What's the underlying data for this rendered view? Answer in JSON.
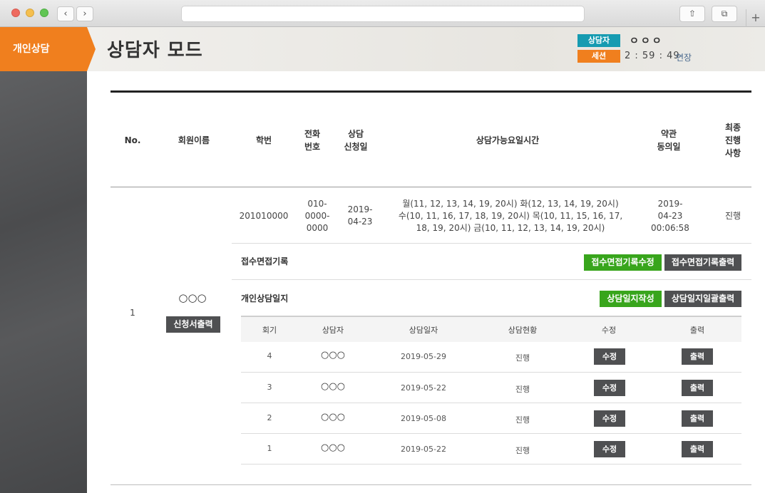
{
  "browser": {
    "back_icon": "‹",
    "forward_icon": "›",
    "share_icon": "⇧",
    "tabs_icon": "⧉",
    "newtab_icon": "+"
  },
  "header": {
    "tab_label": "개인상담",
    "page_title": "상담자 모드",
    "counselor_badge": "상담자",
    "counselor_name": "ㅇㅇㅇ",
    "session_badge": "세션",
    "timer": "2 : 59 : 49",
    "extend_label": "연장"
  },
  "table": {
    "headers": {
      "no": "No.",
      "member_name": "회원이름",
      "student_id": "학번",
      "phone": [
        "전화",
        "번호"
      ],
      "request_date": [
        "상담",
        "신청일"
      ],
      "available_time": "상담가능요일시간",
      "agreement_date": [
        "약관",
        "동의일"
      ],
      "final_status": [
        "최종",
        "진행",
        "사항"
      ]
    },
    "row": {
      "no": "1",
      "member_name": "○○○",
      "print_application_label": "신청서출력",
      "student_id": "201010000",
      "phone": [
        "010-",
        "0000-",
        "0000"
      ],
      "request_date": [
        "2019-",
        "04-23"
      ],
      "available_time": [
        "월(11, 12, 13, 14, 19, 20시) 화(12, 13, 14, 19, 20시)",
        "수(10, 11, 16, 17, 18, 19, 20시) 목(10, 11, 15, 16, 17,",
        "18, 19, 20시) 금(10, 11, 12, 13, 14, 19, 20시)"
      ],
      "agreement_date": [
        "2019-",
        "04-23",
        "00:06:58"
      ],
      "final_status": "진행"
    }
  },
  "intake": {
    "label": "접수면접기록",
    "edit_label": "접수면접기록수정",
    "print_label": "접수면접기록출력"
  },
  "journal": {
    "label": "개인상담일지",
    "write_label": "상담일지작성",
    "print_all_label": "상담일지일괄출력",
    "headers": {
      "session": "회기",
      "counselor": "상담자",
      "date": "상담일자",
      "status": "상담현황",
      "edit": "수정",
      "print": "출력"
    },
    "rows": [
      {
        "session": "4",
        "counselor": "○○○",
        "date": "2019-05-29",
        "status": "진행",
        "edit": "수정",
        "print": "출력"
      },
      {
        "session": "3",
        "counselor": "○○○",
        "date": "2019-05-22",
        "status": "진행",
        "edit": "수정",
        "print": "출력"
      },
      {
        "session": "2",
        "counselor": "○○○",
        "date": "2019-05-08",
        "status": "진행",
        "edit": "수정",
        "print": "출력"
      },
      {
        "session": "1",
        "counselor": "○○○",
        "date": "2019-05-22",
        "status": "진행",
        "edit": "수정",
        "print": "출력"
      }
    ]
  },
  "colors": {
    "accent_orange": "#f07f1e",
    "badge_teal": "#169bb1",
    "button_green": "#38a51c",
    "button_gray": "#4f5052"
  }
}
